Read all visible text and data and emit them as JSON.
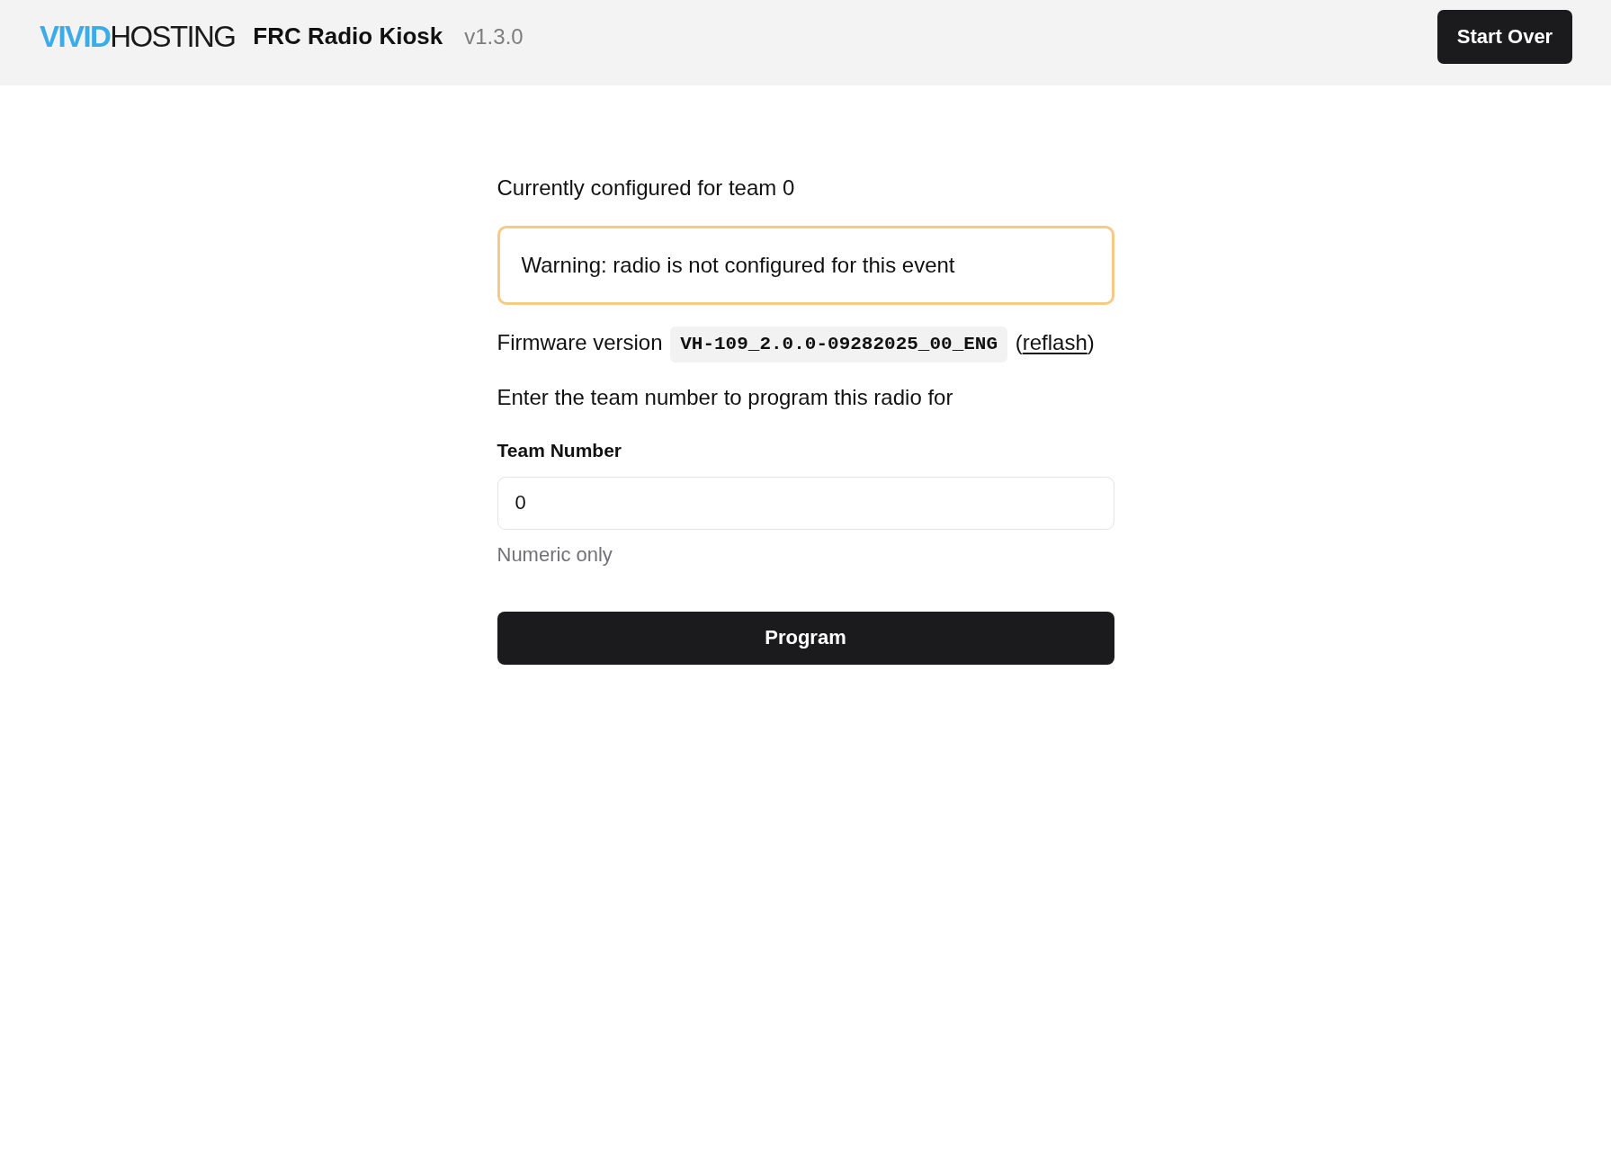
{
  "header": {
    "logo": {
      "accent": "VIVID",
      "rest": "HOSTING"
    },
    "title": "FRC Radio Kiosk",
    "version": "v1.3.0",
    "start_over_button": "Start Over"
  },
  "status": "Currently configured for team 0",
  "alert": {
    "kind": "warning",
    "text": "Warning: radio is not configured for this event"
  },
  "firmware": {
    "label": "Firmware version",
    "version": "VH-109_2.0.0-09282025_00_ENG",
    "link_prefix": "(",
    "link": "reflash",
    "link_suffix": ")"
  },
  "instruction": "Enter the team number to program this radio for",
  "team_field": {
    "label": "Team Number",
    "value": "0",
    "hint": "Numeric only"
  },
  "program_button": "Program"
}
